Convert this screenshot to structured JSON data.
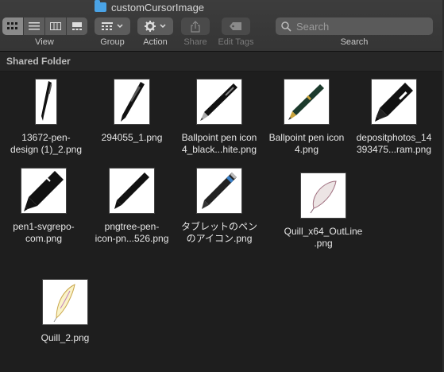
{
  "window": {
    "title": "customCursorImage"
  },
  "toolbar": {
    "view_label": "View",
    "group_label": "Group",
    "action_label": "Action",
    "share_label": "Share",
    "edit_tags_label": "Edit Tags",
    "search_label": "Search",
    "search_placeholder": "Search"
  },
  "section": {
    "header": "Shared Folder"
  },
  "files": [
    {
      "line1": "13672-pen-",
      "line2": "design (1)_2.png",
      "icon": "pen-thin-icon"
    },
    {
      "line1": "294055_1.png",
      "line2": "",
      "icon": "pen-slim-icon"
    },
    {
      "line1": "Ballpoint pen icon",
      "line2": "4_black...hite.png",
      "icon": "ballpoint-pen-icon"
    },
    {
      "line1": "Ballpoint pen icon",
      "line2": "4.png",
      "icon": "green-pen-icon"
    },
    {
      "line1": "depositphotos_14",
      "line2": "393475...ram.png",
      "icon": "marker-pen-icon"
    },
    {
      "line1": "pen1-svgrepo-",
      "line2": "com.png",
      "icon": "fat-pen-icon"
    },
    {
      "line1": "pngtree-pen-",
      "line2": "icon-pn...526.png",
      "icon": "slim-pen-icon"
    },
    {
      "line1": "タブレットのペン",
      "line2": "のアイコン.png",
      "icon": "tablet-pen-icon"
    },
    {
      "line1": "Quill_x64_OutLine",
      "line2": ".png",
      "icon": "quill-outline-icon"
    },
    {
      "line1": "Quill_2.png",
      "line2": "",
      "icon": "quill-icon"
    }
  ]
}
